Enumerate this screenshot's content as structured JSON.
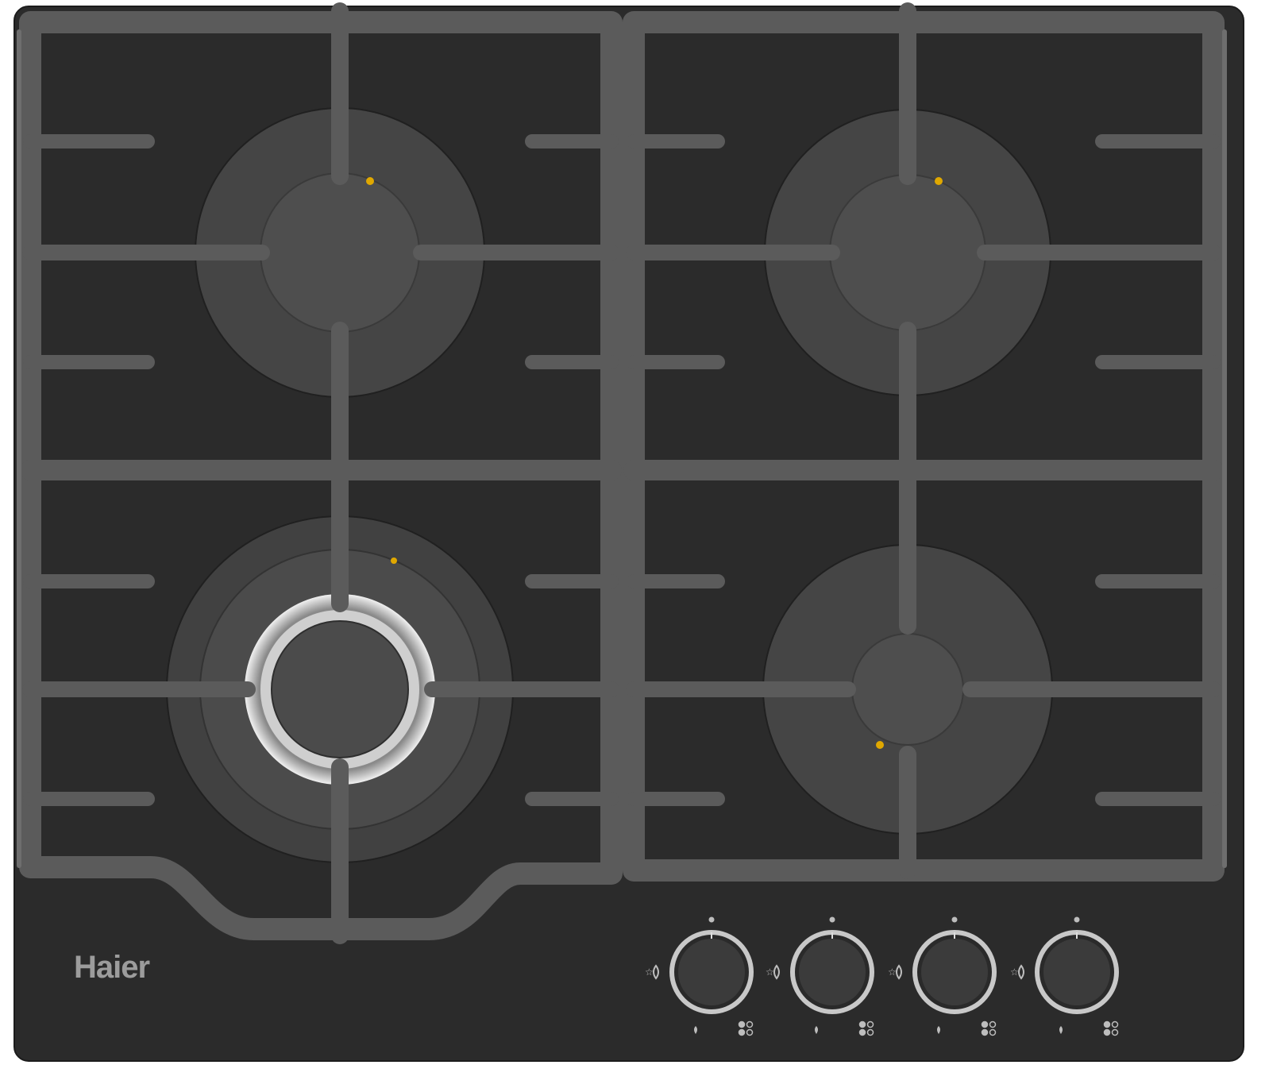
{
  "brand": {
    "name": "Haier"
  },
  "hob": {
    "burners": [
      {
        "id": "rear-left",
        "type": "standard"
      },
      {
        "id": "rear-right",
        "type": "standard"
      },
      {
        "id": "front-left",
        "type": "triple-crown wok"
      },
      {
        "id": "front-right",
        "type": "standard"
      }
    ],
    "controls": [
      {
        "id": "knob-1",
        "icons": [
          "star-icon",
          "flame-icon",
          "ignition-icon",
          "burner-position-icon"
        ]
      },
      {
        "id": "knob-2",
        "icons": [
          "star-icon",
          "flame-icon",
          "ignition-icon",
          "burner-position-icon"
        ]
      },
      {
        "id": "knob-3",
        "icons": [
          "star-icon",
          "flame-icon",
          "ignition-icon",
          "burner-position-icon"
        ]
      },
      {
        "id": "knob-4",
        "icons": [
          "star-icon",
          "flame-icon",
          "ignition-icon",
          "burner-position-icon"
        ]
      }
    ]
  },
  "colors": {
    "glass": "#2b2b2b",
    "cast_iron": "#5a5a5a",
    "burner_cap": "#4a4a4a",
    "burner_ring": "#444444",
    "electrode": "#e0a800",
    "brand_text": "#9c9c9c",
    "knob_ring": "#c8c8c8",
    "symbols": "#bdbdbd"
  }
}
